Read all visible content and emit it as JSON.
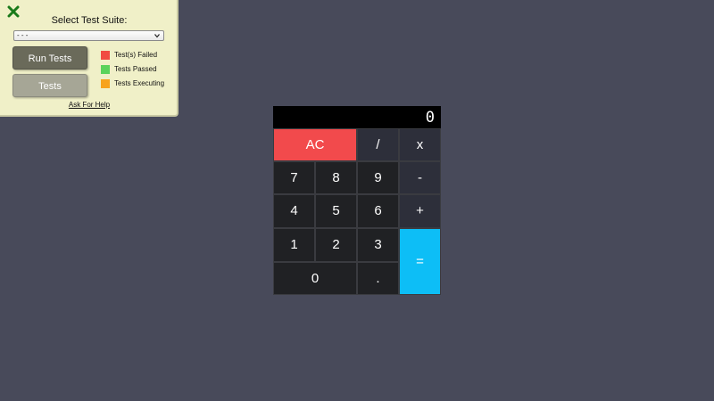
{
  "test_panel": {
    "title": "Select Test Suite:",
    "selected_suite": "- - -",
    "run_button": "Run Tests",
    "tests_button": "Tests",
    "legend": [
      {
        "label": "Test(s) Failed",
        "color": "#f14b42"
      },
      {
        "label": "Tests Passed",
        "color": "#5bd35b"
      },
      {
        "label": "Tests Executing",
        "color": "#f7a31c"
      }
    ],
    "help_link": "Ask For Help",
    "close_icon_color": "#1a7a1a"
  },
  "calculator": {
    "display": "0",
    "keys": {
      "ac": "AC",
      "divide": "/",
      "multiply": "x",
      "seven": "7",
      "eight": "8",
      "nine": "9",
      "subtract": "-",
      "four": "4",
      "five": "5",
      "six": "6",
      "add": "+",
      "one": "1",
      "two": "2",
      "three": "3",
      "equals": "=",
      "zero": "0",
      "decimal": "."
    },
    "colors": {
      "clear": "#f24a4c",
      "equals": "#0dbef6",
      "key": "#202124",
      "operator": "#2d2f3a"
    }
  }
}
